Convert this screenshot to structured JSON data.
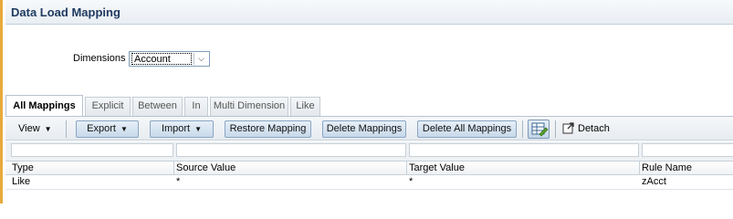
{
  "title": "Data Load Mapping",
  "dimension": {
    "label": "Dimensions",
    "selected": "Account"
  },
  "tabs": [
    {
      "label": "All Mappings",
      "active": true
    },
    {
      "label": "Explicit"
    },
    {
      "label": "Between"
    },
    {
      "label": "In"
    },
    {
      "label": "Multi Dimension"
    },
    {
      "label": "Like"
    }
  ],
  "toolbar": {
    "view": "View",
    "export": "Export",
    "import": "Import",
    "restore": "Restore Mapping",
    "delete": "Delete Mappings",
    "delete_all": "Delete All Mappings",
    "detach": "Detach"
  },
  "table": {
    "columns": [
      "Type",
      "Source Value",
      "Target Value",
      "Rule Name"
    ],
    "rows": [
      [
        "Like",
        "*",
        "*",
        "zAcct"
      ]
    ]
  },
  "colors": {
    "accent": "#e8a93a",
    "title_text": "#1f3a60",
    "button_fill": "#c8d9ea"
  }
}
